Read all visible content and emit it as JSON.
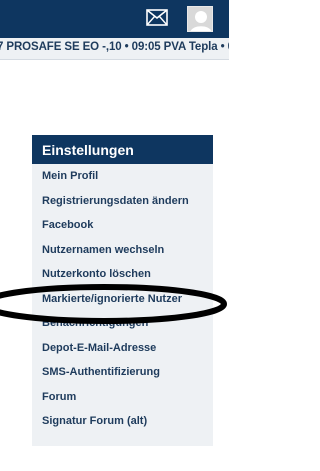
{
  "header": {
    "mail_icon": "envelope-icon",
    "avatar_icon": "user-avatar-icon"
  },
  "ticker": {
    "text": "7 PROSAFE SE EO -,10 • 09:05 PVA Tepla • 0"
  },
  "settings": {
    "title": "Einstellungen",
    "items": [
      {
        "label": "Mein Profil"
      },
      {
        "label": "Registrierungsdaten ändern"
      },
      {
        "label": "Facebook"
      },
      {
        "label": "Nutzernamen wechseln"
      },
      {
        "label": "Nutzerkonto löschen"
      },
      {
        "label": "Markierte/ignorierte Nutzer"
      },
      {
        "label": "Benachrichtigungen"
      },
      {
        "label": "Depot-E-Mail-Adresse"
      },
      {
        "label": "SMS-Authentifizierung"
      },
      {
        "label": "Forum"
      },
      {
        "label": "Signatur Forum (alt)"
      }
    ]
  },
  "colors": {
    "navy": "#0e3660",
    "panel_bg": "#eef1f4",
    "link": "#1e3b5c"
  }
}
